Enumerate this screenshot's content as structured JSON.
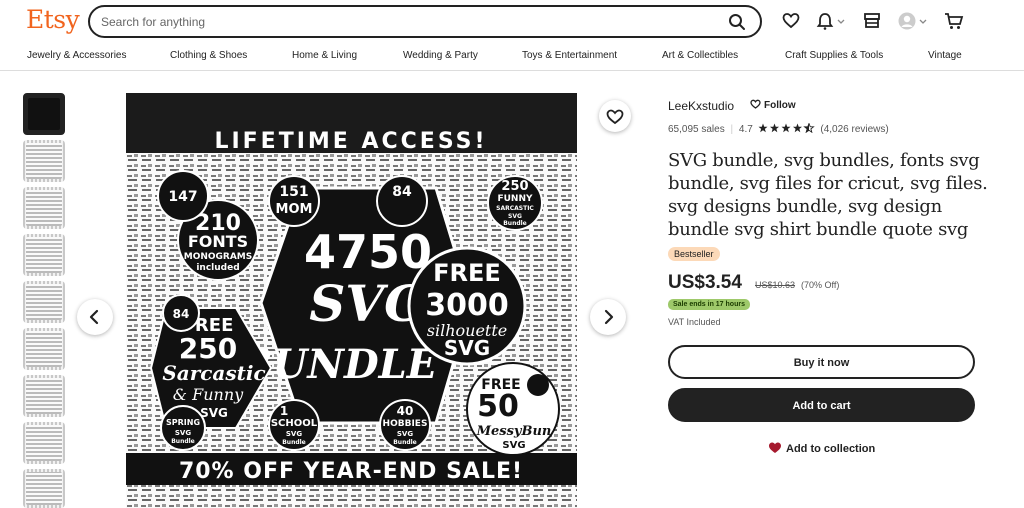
{
  "header": {
    "logo": "Etsy",
    "search_placeholder": "Search for anything",
    "icons": [
      "search-icon",
      "heart-icon",
      "bell-icon",
      "shop-manager-icon",
      "avatar",
      "cart-icon"
    ]
  },
  "categories": [
    "Jewelry & Accessories",
    "Clothing & Shoes",
    "Home & Living",
    "Wedding & Party",
    "Toys & Entertainment",
    "Art & Collectibles",
    "Craft Supplies & Tools",
    "Vintage"
  ],
  "gallery": {
    "banner_top": "LIFETIME ACCESS!",
    "banner_bottom": "70% OFF YEAR-END SALE!",
    "badges": {
      "main_number": "4750",
      "main_line1": "SVG",
      "main_line2": "BUNDLE",
      "free_label": "FREE",
      "free_number": "3000",
      "free_line1": "silhouette",
      "free_line2": "SVG",
      "fonts_number": "210",
      "fonts_label": "FONTS",
      "fonts_sub": "MONOGRAMS",
      "fonts_sub2": "included",
      "sarcastic_free": "FREE",
      "sarcastic_number": "250",
      "sarcastic_line1": "Sarcastic",
      "sarcastic_line2": "& Funny",
      "sarcastic_line3": "SVG",
      "messy_free": "FREE",
      "messy_number": "50",
      "messy_line1": "MessyBun",
      "messy_line2": "SVG",
      "small_147": "147",
      "small_151": "151",
      "small_151_label": "MOM",
      "small_84": "84",
      "small_250": "250",
      "small_250_label": "FUNNY",
      "small_250_sub": "SARCASTIC",
      "small_250_sub2": "SVG",
      "small_250_sub3": "Bundle",
      "small_84b": "84",
      "small_school": "SCHOOL",
      "small_school_sub": "SVG",
      "small_school_sub2": "Bundle",
      "small_hobbies": "HOBBIES",
      "small_hobbies_sub": "SVG",
      "small_hobbies_sub2": "Bundle",
      "small_spring": "SPRING",
      "small_spring_sub": "SVG",
      "small_spring_sub2": "Bundle",
      "small_40": "40",
      "small_1": "1"
    }
  },
  "listing": {
    "shop_name": "LeeKxstudio",
    "follow_label": "Follow",
    "sales": "65,095 sales",
    "rating": "4.7",
    "reviews": "(4,026 reviews)",
    "title": "SVG bundle, svg bundles, fonts svg bundle, svg files for cricut, svg files. svg designs bundle, svg design bundle svg shirt bundle quote svg",
    "badge": "Bestseller",
    "price": "US$3.54",
    "original_price": "US$10.63",
    "discount": "(70% Off)",
    "sale_ends": "Sale ends in 17 hours",
    "vat": "VAT Included",
    "buy_now": "Buy it now",
    "add_to_cart": "Add to cart",
    "add_to_collection": "Add to collection"
  },
  "colors": {
    "brand": "#f1641e",
    "bestseller_bg": "#fcd9b8",
    "sale_bg": "#9ec96a",
    "collection_heart": "#a61a2e"
  }
}
